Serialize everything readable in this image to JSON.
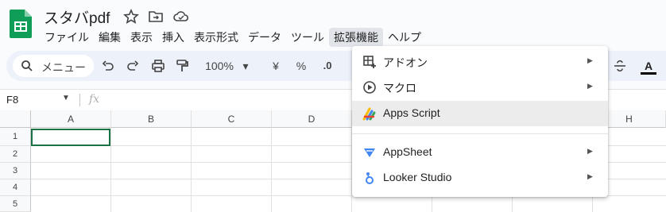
{
  "app": {
    "title": "スタバpdf",
    "brand_color": "#0f9d58"
  },
  "menubar": [
    "ファイル",
    "編集",
    "表示",
    "挿入",
    "表示形式",
    "データ",
    "ツール",
    "拡張機能",
    "ヘルプ"
  ],
  "toolbar": {
    "search_label": "メニュー",
    "zoom": "100%",
    "currency": "¥",
    "percent": "%",
    "decimal": ".0",
    "text_color_label": "A"
  },
  "formula_bar": {
    "cell_ref": "F8",
    "fx": "fx"
  },
  "grid": {
    "columns": [
      "A",
      "B",
      "C",
      "D",
      "H"
    ],
    "rows": [
      "1",
      "2",
      "3",
      "4",
      "5"
    ]
  },
  "extensions_menu": {
    "items": [
      {
        "label": "アドオン",
        "icon": "addon-icon",
        "submenu": true
      },
      {
        "label": "マクロ",
        "icon": "macro-play-icon",
        "submenu": true
      },
      {
        "label": "Apps Script",
        "icon": "apps-script-icon",
        "submenu": false
      },
      {
        "label": "AppSheet",
        "icon": "appsheet-icon",
        "submenu": true
      },
      {
        "label": "Looker Studio",
        "icon": "looker-studio-icon",
        "submenu": true
      }
    ]
  }
}
